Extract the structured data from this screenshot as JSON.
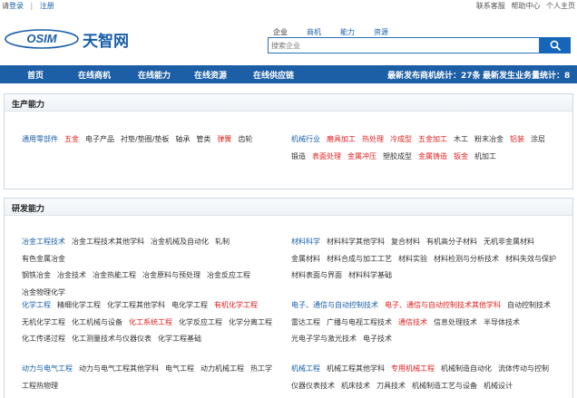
{
  "topbar": {
    "please": "请",
    "login": "登录",
    "sep": "|",
    "register": "注册",
    "right": [
      "联系客服",
      "帮助中心",
      "个人主页"
    ]
  },
  "logo": {
    "text_en": "OSIM",
    "text_cn": "天智网"
  },
  "search": {
    "tabs": [
      "企业",
      "商机",
      "能力",
      "资源"
    ],
    "active_tab": "企业",
    "placeholder": "搜索企业"
  },
  "nav": {
    "items": [
      "首页",
      "在线商机",
      "在线能力",
      "在线资源",
      "在线供应链"
    ],
    "stat1": "最新发布商机统计：27条",
    "stat2": "最新发生业务量统计：8"
  },
  "production": {
    "title": "生产能力",
    "left": [
      [
        {
          "t": "通用零部件",
          "c": "head"
        },
        {
          "t": "五金",
          "c": "red"
        },
        {
          "t": "电子产品",
          "c": "n"
        },
        {
          "t": "衬垫/垫圈/垫板",
          "c": "n"
        },
        {
          "t": "轴承",
          "c": "n"
        },
        {
          "t": "管类",
          "c": "n"
        },
        {
          "t": "弹簧",
          "c": "red"
        },
        {
          "t": "齿轮",
          "c": "n"
        }
      ]
    ],
    "right": [
      [
        {
          "t": "机械行业",
          "c": "head"
        },
        {
          "t": "磨具加工",
          "c": "red"
        },
        {
          "t": "热处理",
          "c": "red"
        },
        {
          "t": "冷成型",
          "c": "red"
        },
        {
          "t": "五金加工",
          "c": "red"
        },
        {
          "t": "木工",
          "c": "n"
        },
        {
          "t": "粉末冶金",
          "c": "n"
        },
        {
          "t": "铝装",
          "c": "red"
        },
        {
          "t": "涂层",
          "c": "n"
        }
      ],
      [
        {
          "t": "锻造",
          "c": "n"
        },
        {
          "t": "表面处理",
          "c": "red"
        },
        {
          "t": "金属冲压",
          "c": "red"
        },
        {
          "t": "塑胶成型",
          "c": "n"
        },
        {
          "t": "金属铸造",
          "c": "red"
        },
        {
          "t": "钣金",
          "c": "red"
        },
        {
          "t": "机加工",
          "c": "n"
        }
      ]
    ]
  },
  "research": {
    "title": "研发能力",
    "groups": [
      {
        "left": [
          [
            {
              "t": "冶金工程技术",
              "c": "head"
            },
            {
              "t": "冶金工程技术其他学科",
              "c": "n"
            },
            {
              "t": "冶金机械及自动化",
              "c": "n"
            },
            {
              "t": "轧制",
              "c": "n"
            },
            {
              "t": "有色金属冶金",
              "c": "n"
            }
          ],
          [
            {
              "t": "钢铁冶金",
              "c": "n"
            },
            {
              "t": "冶金技术",
              "c": "n"
            },
            {
              "t": "冶金热能工程",
              "c": "n"
            },
            {
              "t": "冶金原料与预处理",
              "c": "n"
            },
            {
              "t": "冶金反应工程",
              "c": "n"
            }
          ],
          [
            {
              "t": "冶金物理化学",
              "c": "n"
            }
          ]
        ],
        "right": [
          [
            {
              "t": "材料科学",
              "c": "head"
            },
            {
              "t": "材料科学其他学科",
              "c": "n"
            },
            {
              "t": "复合材料",
              "c": "n"
            },
            {
              "t": "有机高分子材料",
              "c": "n"
            },
            {
              "t": "无机非金属材料",
              "c": "n"
            }
          ],
          [
            {
              "t": "金属材料",
              "c": "n"
            },
            {
              "t": "材料合成与加工工艺",
              "c": "n"
            },
            {
              "t": "材料实验",
              "c": "n"
            },
            {
              "t": "材料检测与分析技术",
              "c": "n"
            },
            {
              "t": "材料失效与保护",
              "c": "n"
            }
          ],
          [
            {
              "t": "材料表面与界面",
              "c": "n"
            },
            {
              "t": "材料科学基础",
              "c": "n"
            }
          ]
        ]
      },
      {
        "left": [
          [
            {
              "t": "化学工程",
              "c": "head"
            },
            {
              "t": "精细化学工程",
              "c": "n"
            },
            {
              "t": "化学工程其他学科",
              "c": "n"
            },
            {
              "t": "电化学工程",
              "c": "n"
            },
            {
              "t": "有机化学工程",
              "c": "red"
            }
          ],
          [
            {
              "t": "无机化学工程",
              "c": "n"
            },
            {
              "t": "化工机械与设备",
              "c": "n"
            },
            {
              "t": "化工系统工程",
              "c": "red"
            },
            {
              "t": "化学反应工程",
              "c": "n"
            },
            {
              "t": "化学分离工程",
              "c": "n"
            }
          ],
          [
            {
              "t": "化工传递过程",
              "c": "n"
            },
            {
              "t": "化工测量技术与仪器仪表",
              "c": "n"
            },
            {
              "t": "化学工程基础",
              "c": "n"
            }
          ]
        ],
        "right": [
          [
            {
              "t": "电子、通信与自动控制技术",
              "c": "head"
            },
            {
              "t": "电子、通信与自动控制技术其他学科",
              "c": "red"
            },
            {
              "t": "自动控制技术",
              "c": "n"
            }
          ],
          [
            {
              "t": "雷达工程",
              "c": "n"
            },
            {
              "t": "广播与电视工程技术",
              "c": "n"
            },
            {
              "t": "通信技术",
              "c": "red"
            },
            {
              "t": "信息处理技术",
              "c": "n"
            },
            {
              "t": "半导体技术",
              "c": "n"
            }
          ],
          [
            {
              "t": "光电子学与激光技术",
              "c": "n"
            },
            {
              "t": "电子技术",
              "c": "n"
            }
          ]
        ]
      },
      {
        "left": [
          [
            {
              "t": "动力与电气工程",
              "c": "head"
            },
            {
              "t": "动力与电气工程其他学科",
              "c": "n"
            },
            {
              "t": "电气工程",
              "c": "n"
            },
            {
              "t": "动力机械工程",
              "c": "n"
            },
            {
              "t": "热工学",
              "c": "n"
            }
          ],
          [
            {
              "t": "工程热物理",
              "c": "n"
            }
          ]
        ],
        "right": [
          [
            {
              "t": "机械工程",
              "c": "head"
            },
            {
              "t": "机械工程其他学科",
              "c": "n"
            },
            {
              "t": "专用机械工程",
              "c": "red"
            },
            {
              "t": "机械制造自动化",
              "c": "n"
            },
            {
              "t": "流体传动与控制",
              "c": "n"
            }
          ],
          [
            {
              "t": "仪器仪表技术",
              "c": "n"
            },
            {
              "t": "机床技术",
              "c": "n"
            },
            {
              "t": "刀具技术",
              "c": "n"
            },
            {
              "t": "机械制造工艺与设备",
              "c": "n"
            },
            {
              "t": "机械设计",
              "c": "n"
            }
          ]
        ]
      }
    ]
  },
  "colors": {
    "nav_bg": "#1d5fa6",
    "link": "#1a5fa8",
    "highlight": "#e02020"
  }
}
